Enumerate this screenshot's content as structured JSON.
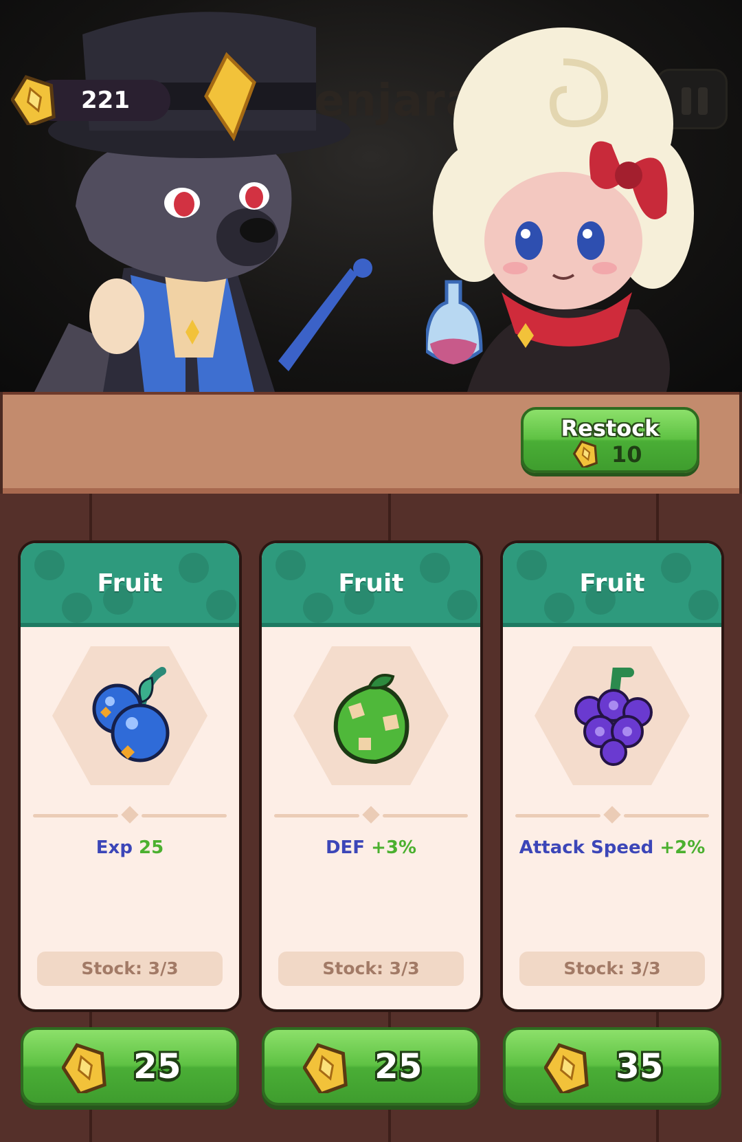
{
  "hud": {
    "gold_balance": "221",
    "gold_icon": "gold-gem-coin-icon",
    "background_title": "Penjara",
    "pause_icon": "pause-icon"
  },
  "scene": {
    "characters": [
      "wolf-merchant-character",
      "sheep-alchemist-character"
    ]
  },
  "restock": {
    "label": "Restock",
    "cost": "10",
    "cost_icon": "gold-gem-coin-icon"
  },
  "cards": [
    {
      "category": "Fruit",
      "item_icon": "blueberry-icon",
      "stat_name": "Exp",
      "stat_value": "25",
      "stock": "Stock: 3/3",
      "price": "25"
    },
    {
      "category": "Fruit",
      "item_icon": "green-fruit-icon",
      "stat_name": "DEF",
      "stat_value": "+3%",
      "stock": "Stock: 3/3",
      "price": "25"
    },
    {
      "category": "Fruit",
      "item_icon": "purple-grape-icon",
      "stat_name": "Attack Speed",
      "stat_value": "+2%",
      "stock": "Stock: 3/3",
      "price": "35"
    }
  ],
  "colors": {
    "card_header": "#2e9a7d",
    "button_green": "#5fc244",
    "stat_name": "#3c46b8",
    "stat_value": "#4bb02f",
    "wood": "#55302a",
    "restock_bar": "#c38b6d"
  }
}
